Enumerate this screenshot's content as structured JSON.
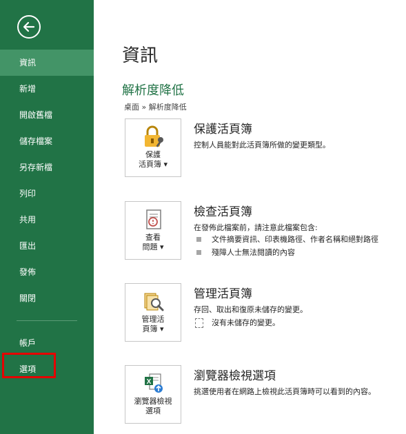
{
  "sidebar": {
    "back_icon": "back-arrow-icon",
    "items": [
      {
        "label": "資訊",
        "active": true
      },
      {
        "label": "新增"
      },
      {
        "label": "開啟舊檔"
      },
      {
        "label": "儲存檔案"
      },
      {
        "label": "另存新檔"
      },
      {
        "label": "列印"
      },
      {
        "label": "共用"
      },
      {
        "label": "匯出"
      },
      {
        "label": "發佈"
      },
      {
        "label": "關閉"
      }
    ],
    "bottom_items": [
      {
        "label": "帳戶"
      },
      {
        "label": "選項",
        "highlighted": true
      }
    ],
    "bg_color": "#217346",
    "active_color": "#439467",
    "highlight_color": "#e60000"
  },
  "main": {
    "title": "資訊",
    "file_name": "解析度降低",
    "breadcrumb": "桌面 » 解析度降低",
    "sections": [
      {
        "tile_label": "保護\n活頁簿 ▾",
        "tile_icon": "lock-key-icon",
        "title": "保護活頁簿",
        "desc": "控制人員能對此活頁簿所做的變更類型。"
      },
      {
        "tile_label": "查看\n問題 ▾",
        "tile_icon": "inspect-document-icon",
        "title": "檢查活頁簿",
        "desc": "在發佈此檔案前，請注意此檔案包含:",
        "bullets": [
          "文件摘要資訊、印表機路徑、作者名稱和絕對路徑",
          "殘障人士無法閱讀的內容"
        ]
      },
      {
        "tile_label": "管理活\n頁簿 ▾",
        "tile_icon": "manage-versions-icon",
        "title": "管理活頁簿",
        "desc": "存回、取出和復原未儲存的變更。",
        "note": "沒有未儲存的變更。"
      },
      {
        "tile_label": "瀏覽器檢視\n選項",
        "tile_icon": "browser-view-icon",
        "title": "瀏覽器檢視選項",
        "desc": "挑選使用者在網路上檢視此活頁簿時可以看到的內容。"
      }
    ]
  }
}
